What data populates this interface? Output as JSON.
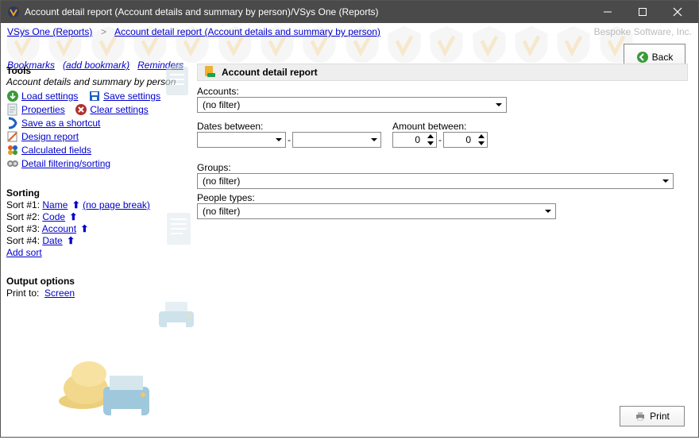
{
  "window": {
    "title": "Account detail report (Account details and summary by person)/VSys One (Reports)"
  },
  "breadcrumb": {
    "root": "VSys One (Reports)",
    "current": "Account detail report (Account details and summary by person)"
  },
  "nav": {
    "bookmarks": "Bookmarks",
    "add_bookmark": "(add bookmark)",
    "reminders": "Reminders"
  },
  "company": "Bespoke Software, Inc.",
  "back_label": "Back",
  "sidebar": {
    "tools_heading": "Tools",
    "tools_sub": "Account details and summary by person",
    "load_settings": "Load settings",
    "save_settings": "Save settings",
    "properties": "Properties",
    "clear_settings": "Clear settings",
    "save_shortcut": "Save as a shortcut",
    "design_report": "Design report",
    "calculated_fields": "Calculated fields",
    "detail_filtering": "Detail filtering/sorting",
    "sorting_heading": "Sorting",
    "sorts": [
      {
        "prefix": "Sort #1:",
        "field": "Name",
        "extra": "(no page break)"
      },
      {
        "prefix": "Sort #2:",
        "field": "Code",
        "extra": ""
      },
      {
        "prefix": "Sort #3:",
        "field": "Account",
        "extra": ""
      },
      {
        "prefix": "Sort #4:",
        "field": "Date",
        "extra": ""
      }
    ],
    "add_sort": "Add sort",
    "output_heading": "Output options",
    "print_to_label": "Print to:",
    "print_to_value": "Screen"
  },
  "main": {
    "panel_title": "Account detail report",
    "accounts_label": "Accounts:",
    "accounts_value": "(no filter)",
    "dates_label": "Dates between:",
    "amount_label": "Amount between:",
    "amount_from": "0",
    "amount_to": "0",
    "groups_label": "Groups:",
    "groups_value": "(no filter)",
    "people_types_label": "People types:",
    "people_types_value": "(no filter)"
  },
  "print_label": "Print"
}
